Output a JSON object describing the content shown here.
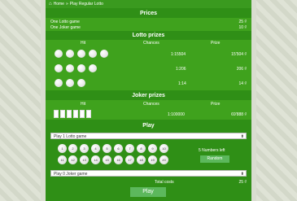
{
  "breadcrumb": {
    "home": "Home",
    "separator": "»",
    "current": "Play Regular Lotto"
  },
  "prices": {
    "title": "Prices",
    "rows": [
      {
        "label": "One Lotto game",
        "value": "25 ₫"
      },
      {
        "label": "One Joker game",
        "value": "10 ₫"
      }
    ]
  },
  "lotto_prizes": {
    "title": "Lotto prizes",
    "headers": {
      "hit": "Hit",
      "chances": "Chances",
      "prize": "Prize"
    },
    "rows": [
      {
        "balls": 5,
        "chances": "1:15504",
        "prize": "15'504 ₫"
      },
      {
        "balls": 4,
        "chances": "1:206",
        "prize": "206 ₫"
      },
      {
        "balls": 3,
        "chances": "1:14",
        "prize": "14 ₫"
      }
    ]
  },
  "joker_prizes": {
    "title": "Joker prizes",
    "headers": {
      "hit": "Hit",
      "chances": "Chances",
      "prize": "Prize"
    },
    "row": {
      "squares": 6,
      "chances": "1:100000",
      "prize": "69'888 ₫"
    }
  },
  "play": {
    "title": "Play",
    "lotto_select": "Play 1 Lotto game",
    "joker_select": "Play 0 Joker game",
    "numbers_left": "5 Numbers left",
    "random_button": "Random",
    "total_label": "Total costs",
    "total_value": "25 ₫",
    "play_button": "Play",
    "numbers_row1": [
      "1",
      "2",
      "3",
      "4",
      "5",
      "6",
      "7",
      "8",
      "9",
      "10"
    ],
    "numbers_row2": [
      "11",
      "12",
      "13",
      "14",
      "15",
      "16",
      "17",
      "18",
      "19",
      "20"
    ]
  },
  "colors": {
    "panel": "#2f8f16",
    "box": "#3fa21d",
    "button": "#5cb85c"
  }
}
